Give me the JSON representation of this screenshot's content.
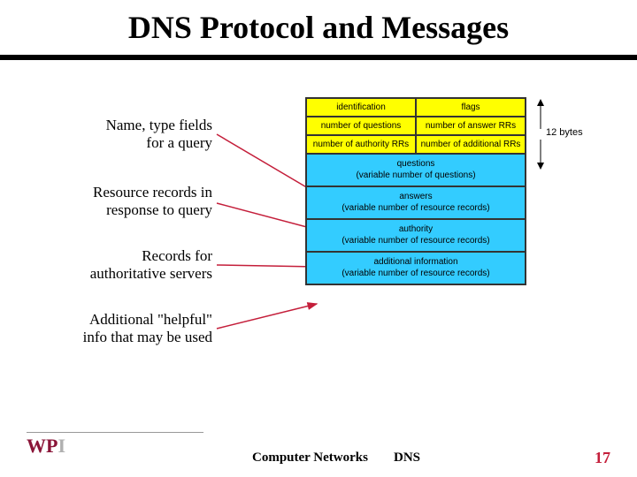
{
  "title": "DNS Protocol and Messages",
  "labels": {
    "l1a": "Name, type fields",
    "l1b": "for a query",
    "l2a": "Resource records in",
    "l2b": "response to query",
    "l3a": "Records for",
    "l3b": "authoritative servers",
    "l4a": "Additional \"helpful\"",
    "l4b": "info that may be used"
  },
  "diagram": {
    "r1c1": "identification",
    "r1c2": "flags",
    "r2c1": "number of questions",
    "r2c2": "number of answer RRs",
    "r3c1": "number of authority RRs",
    "r3c2": "number of additional RRs",
    "b1a": "questions",
    "b1b": "(variable number of questions)",
    "b2a": "answers",
    "b2b": "(variable number of resource records)",
    "b3a": "authority",
    "b3b": "(variable number of resource records)",
    "b4a": "additional information",
    "b4b": "(variable number of resource records)"
  },
  "bracket_label": "12 bytes",
  "footer": {
    "course": "Computer Networks",
    "topic": "DNS",
    "page": "17",
    "logo_w": "W",
    "logo_p": "P",
    "logo_i": "I"
  }
}
